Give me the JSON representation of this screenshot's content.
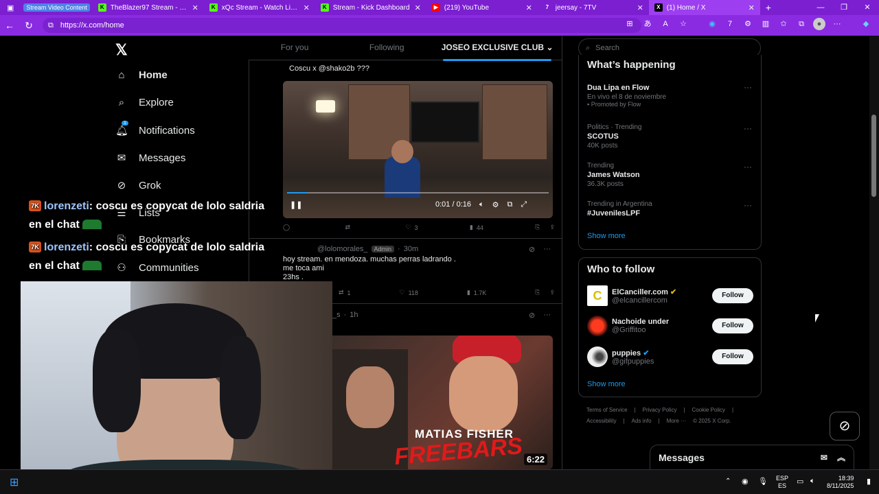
{
  "browser": {
    "tab_group_label": "Stream Video Content",
    "tabs": [
      {
        "title": "TheBlazer97 Stream - Watch",
        "icon": "kick-icon"
      },
      {
        "title": "xQc Stream - Watch Live on",
        "icon": "kick-icon"
      },
      {
        "title": "Stream - Kick Dashboard",
        "icon": "kick-icon"
      },
      {
        "title": "(219) YouTube",
        "icon": "youtube-icon"
      },
      {
        "title": "jeersay - 7TV",
        "icon": "7tv-icon"
      },
      {
        "title": "(1) Home / X",
        "icon": "x-icon"
      }
    ],
    "url": "https://x.com/home"
  },
  "sidebar": {
    "items": [
      {
        "label": "Home",
        "icon": "home-icon"
      },
      {
        "label": "Explore",
        "icon": "search-icon"
      },
      {
        "label": "Notifications",
        "icon": "bell-icon"
      },
      {
        "label": "Messages",
        "icon": "mail-icon"
      },
      {
        "label": "Grok",
        "icon": "grok-icon"
      },
      {
        "label": "Lists",
        "icon": "list-icon"
      },
      {
        "label": "Bookmarks",
        "icon": "bookmark-icon"
      },
      {
        "label": "Communities",
        "icon": "people-icon"
      }
    ],
    "notification_count": "1"
  },
  "timeline": {
    "tabs": [
      "For you",
      "Following",
      "JOSEO EXCLUSIVE CLUB"
    ],
    "post1": {
      "text": "Coscu x @shako2b ???",
      "video_time": "0:01 / 0:16",
      "replies": "",
      "reposts": "",
      "likes": "3",
      "views": "44"
    },
    "post2": {
      "handle": "@lolomorales_",
      "role": "Admin",
      "time": "30m",
      "text": "hoy stream. en mendoza. muchas perras ladrando .",
      "text2": "me toca ami",
      "text3": "23hs .",
      "reposts": "1",
      "likes": "118",
      "views": "1.7K"
    },
    "post3": {
      "handle": "_s",
      "time": "1h",
      "thumb_title": "MATIAS FISHER",
      "thumb_sub": "FREEBARS",
      "duration": "6:22"
    }
  },
  "right": {
    "search_placeholder": "Search",
    "happening_title": "What’s happening",
    "trends": [
      {
        "sub": "",
        "main": "Dua Lipa en Flow",
        "detail": "En vivo el 8 de noviembre",
        "promo": "Promoted by Flow"
      },
      {
        "sub": "Politics · Trending",
        "main": "SCOTUS",
        "detail": "40K posts",
        "promo": ""
      },
      {
        "sub": "Trending",
        "main": "James Watson",
        "detail": "36.3K posts",
        "promo": ""
      },
      {
        "sub": "Trending in Argentina",
        "main": "#JuvenilesLPF",
        "detail": "",
        "promo": ""
      }
    ],
    "show_more": "Show more",
    "who_title": "Who to follow",
    "who": [
      {
        "name": "ElCanciller.com",
        "handle": "@elcancillercom"
      },
      {
        "name": "Nachoide under",
        "handle": "@Griffitoo"
      },
      {
        "name": "puppies",
        "handle": "@gifpuppies"
      }
    ],
    "follow_label": "Follow",
    "footer1": [
      "Terms of Service",
      "|",
      "Privacy Policy",
      "|",
      "Cookie Policy",
      "|"
    ],
    "footer2": [
      "Accessibility",
      "|",
      "Ads info",
      "|",
      "More ···",
      "© 2025 X Corp."
    ],
    "messages_label": "Messages"
  },
  "overlay": {
    "chat1_user": "lorenzeti",
    "chat1_text": ": coscu es copycat de lolo saldria",
    "chat1_text2": "en el chat",
    "chat2_user": "lorenzeti",
    "chat2_text": ": coscu es copycat de lolo saldria",
    "chat2_text2": "en el chat",
    "badge": "7K"
  },
  "taskbar": {
    "lang": "ESP",
    "lang2": "ES",
    "time": "18:39",
    "date": "8/11/2025"
  },
  "colors": {
    "accent": "#1d9bf0",
    "browser": "#8a2be2"
  }
}
